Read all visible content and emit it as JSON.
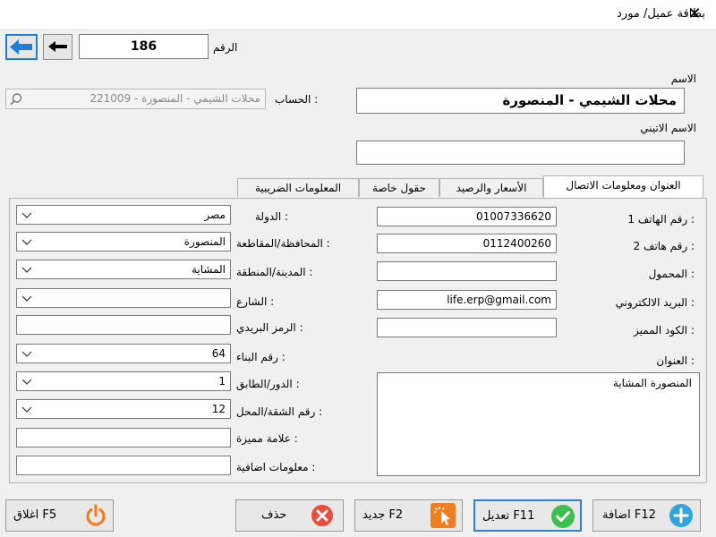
{
  "window": {
    "title": "بطاقة عميل/ مورد"
  },
  "record": {
    "number_label": "الرقم",
    "number_value": "186"
  },
  "name": {
    "label": "الاسم",
    "value": "محلات الشيمي - المنصورة"
  },
  "latin_name": {
    "label": "الاسم الاتيني",
    "value": ""
  },
  "account": {
    "label": "الحساب :",
    "value": "221009 - محلات الشيمي - المنصورة"
  },
  "tabs": [
    {
      "label": "العنوان ومعلومات الاتصال"
    },
    {
      "label": "الأسعار والرصيد"
    },
    {
      "label": "حقول خاصة"
    },
    {
      "label": "المعلومات الضريبية"
    }
  ],
  "contact": {
    "phone1_label": "رقم الهاتف 1 :",
    "phone1_value": "01007336620",
    "phone2_label": "رقم هاتف 2 :",
    "phone2_value": "0112400260",
    "mobile_label": "المحمول :",
    "mobile_value": "",
    "email_label": "البريد الالكتروني :",
    "email_value": "life.erp@gmail.com",
    "code_label": "الكود المميز :",
    "code_value": "",
    "address_label": "العنوان :",
    "address_value": "المنصورة المشاية"
  },
  "location": {
    "country_label": "الدولة :",
    "country_value": "مصر",
    "governorate_label": "المحافظة/المقاطعة :",
    "governorate_value": "المنصورة",
    "city_label": "المدينة/المنطقة :",
    "city_value": "المشاية",
    "street_label": "الشارع :",
    "street_value": "",
    "postal_label": "الرمز البريدي :",
    "postal_value": "",
    "building_label": "رقم البناء :",
    "building_value": "64",
    "floor_label": "الدور/الطابق :",
    "floor_value": "1",
    "apartment_label": "رقم الشقة/المحل :",
    "apartment_value": "12",
    "landmark_label": "علامة مميزة :",
    "landmark_value": "",
    "extra_label": "معلومات اضافية :",
    "extra_value": ""
  },
  "footer": {
    "close_label": "اغلاق F5",
    "delete_label": "حذف",
    "new_label": "جديد F2",
    "edit_label": "تعديل F11",
    "add_label": "اضافة F12"
  },
  "colors": {
    "accent": "#1e7fd8",
    "close_orange": "#f07b1b",
    "delete_red": "#e84c3d",
    "new_orange": "#ef7d22",
    "edit_green": "#3fbf4f",
    "add_blue": "#33a3dc"
  }
}
